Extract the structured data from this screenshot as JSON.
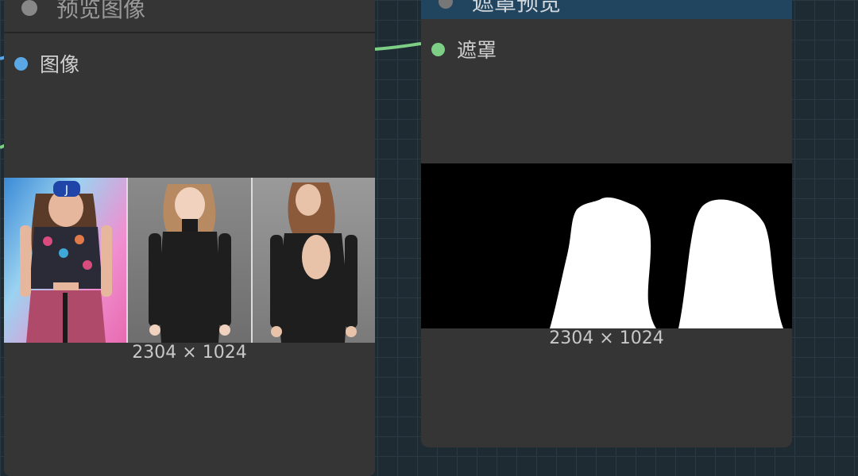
{
  "left_node": {
    "title": "预览图像",
    "input_slot": {
      "label": "图像",
      "color": "#5aa9e6"
    },
    "dimensions": "2304 × 1024"
  },
  "right_node": {
    "title": "遮罩预览",
    "input_slot": {
      "label": "遮罩",
      "color": "#7ccf84"
    },
    "dimensions": "2304 × 1024"
  },
  "colors": {
    "canvas_bg": "#1f2b33",
    "node_bg": "#353535",
    "title_bar_right": "#22455f",
    "wire_blue": "#5aa9e6",
    "wire_green": "#7ccf84"
  }
}
